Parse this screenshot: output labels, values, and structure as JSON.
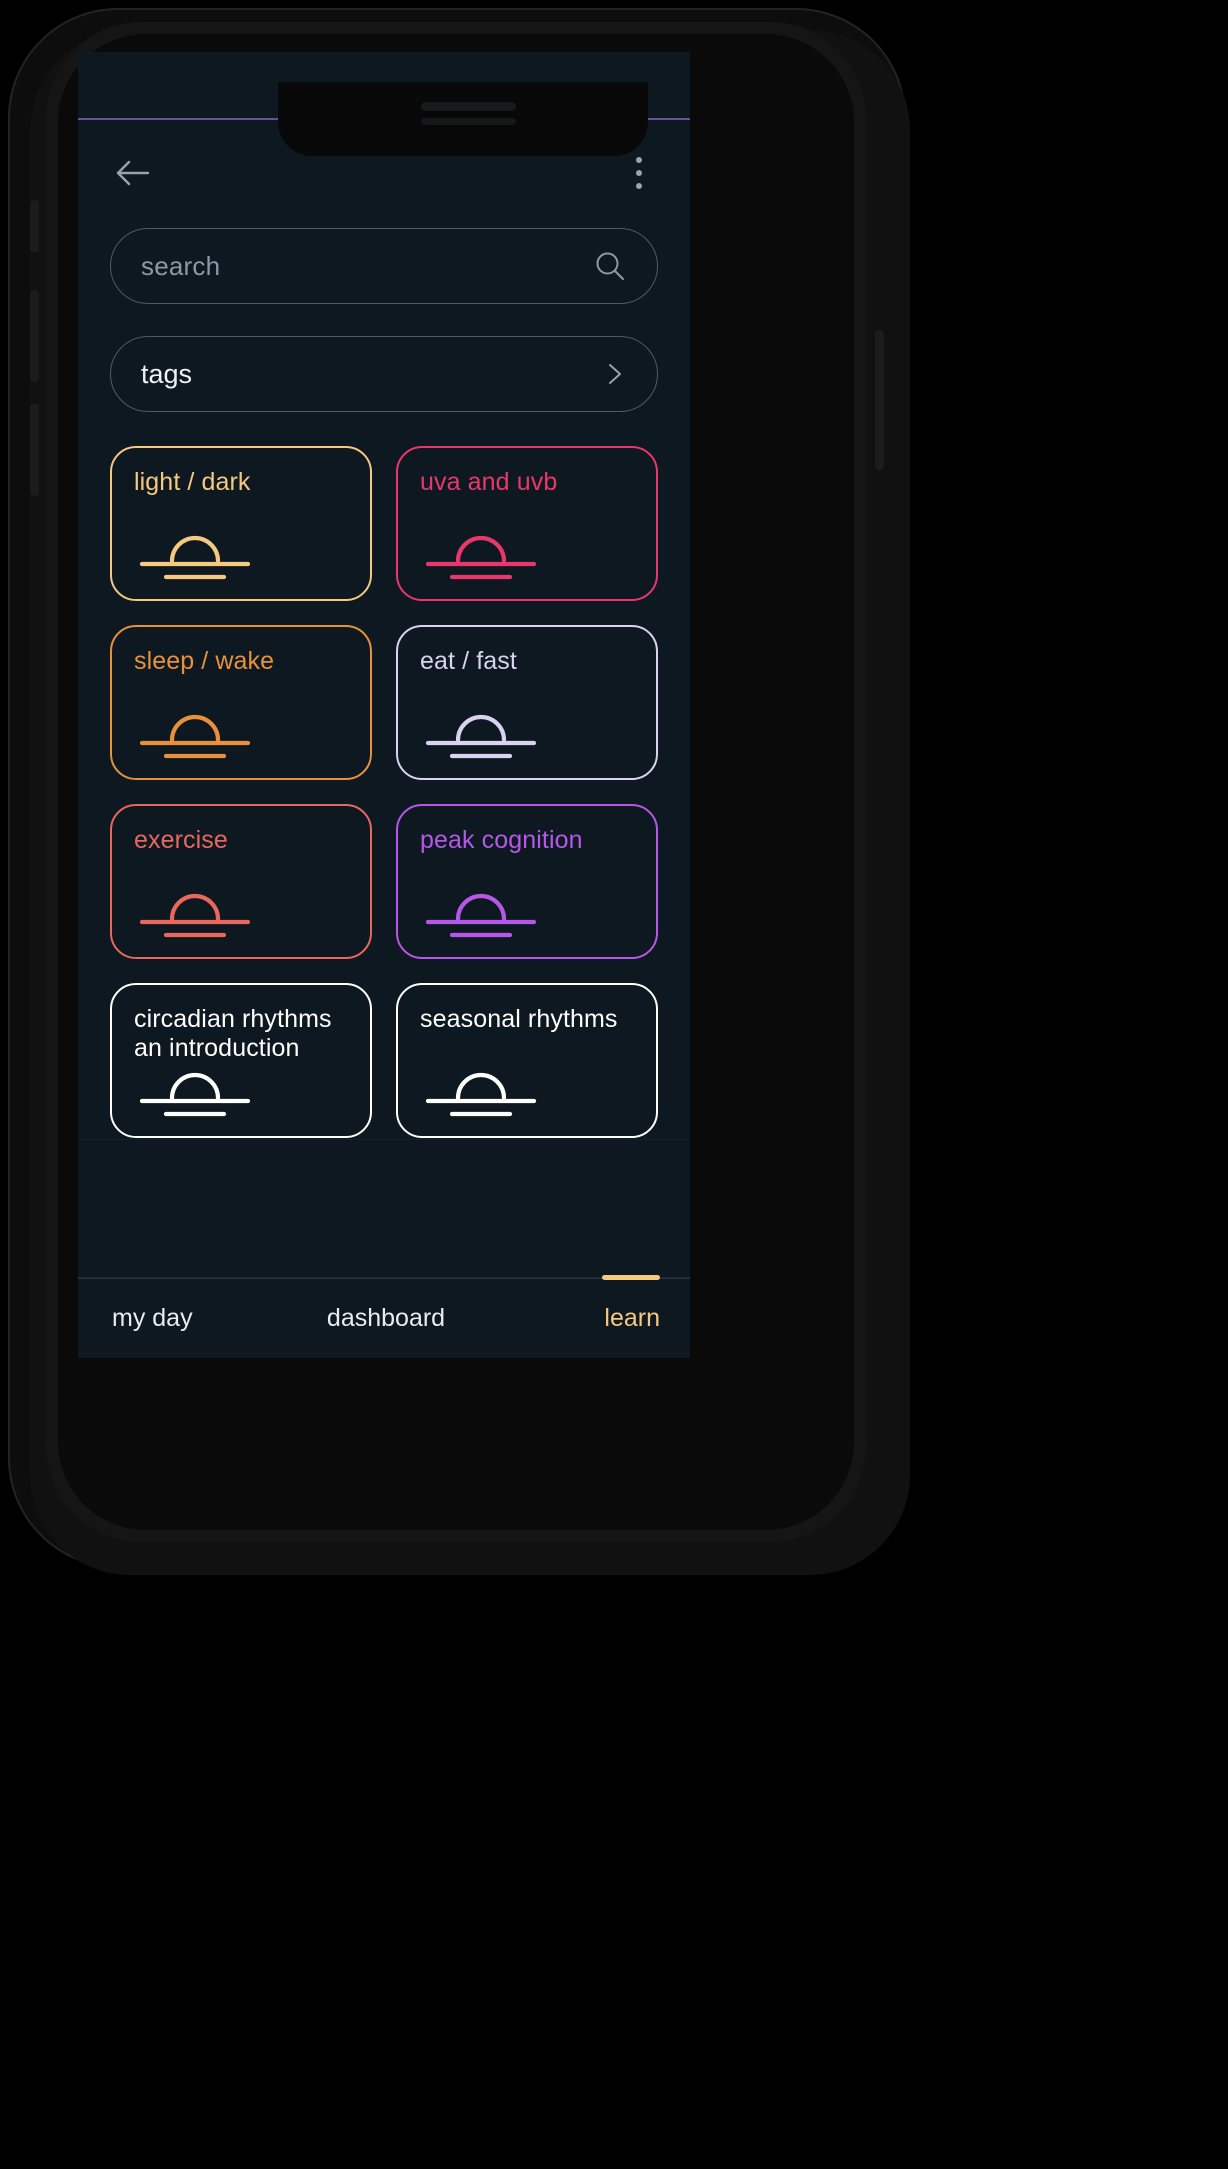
{
  "app": {
    "screen_bg": "#0E1821",
    "divider_color": "#6b4f99"
  },
  "header": {
    "back_icon": "arrow-left-icon",
    "menu_icon": "kebab-menu-icon"
  },
  "search": {
    "placeholder": "search",
    "value": "",
    "icon": "search-icon"
  },
  "tags": {
    "label": "tags",
    "chevron_icon": "chevron-right-icon"
  },
  "cards": [
    {
      "title": "light / dark",
      "color": "#F5C97E",
      "icon": "sunrise-icon"
    },
    {
      "title": "uva and uvb",
      "color": "#E8376B",
      "icon": "sunrise-icon"
    },
    {
      "title": "sleep / wake",
      "color": "#E8913A",
      "icon": "sunrise-icon"
    },
    {
      "title": "eat / fast",
      "color": "#D9D2F0",
      "icon": "sunrise-icon"
    },
    {
      "title": "exercise",
      "color": "#E8685E",
      "icon": "sunrise-icon"
    },
    {
      "title": "peak cognition",
      "color": "#B558E8",
      "icon": "sunrise-icon"
    },
    {
      "title": "circadian rhythms\nan introduction",
      "color": "#FFFFFF",
      "icon": "sunrise-icon"
    },
    {
      "title": "seasonal rhythms",
      "color": "#FFFFFF",
      "icon": "sunrise-icon"
    }
  ],
  "tabbar": {
    "tabs": [
      {
        "label": "my day",
        "active": false
      },
      {
        "label": "dashboard",
        "active": false
      },
      {
        "label": "learn",
        "active": true
      }
    ],
    "active_color": "#F5C97E"
  }
}
